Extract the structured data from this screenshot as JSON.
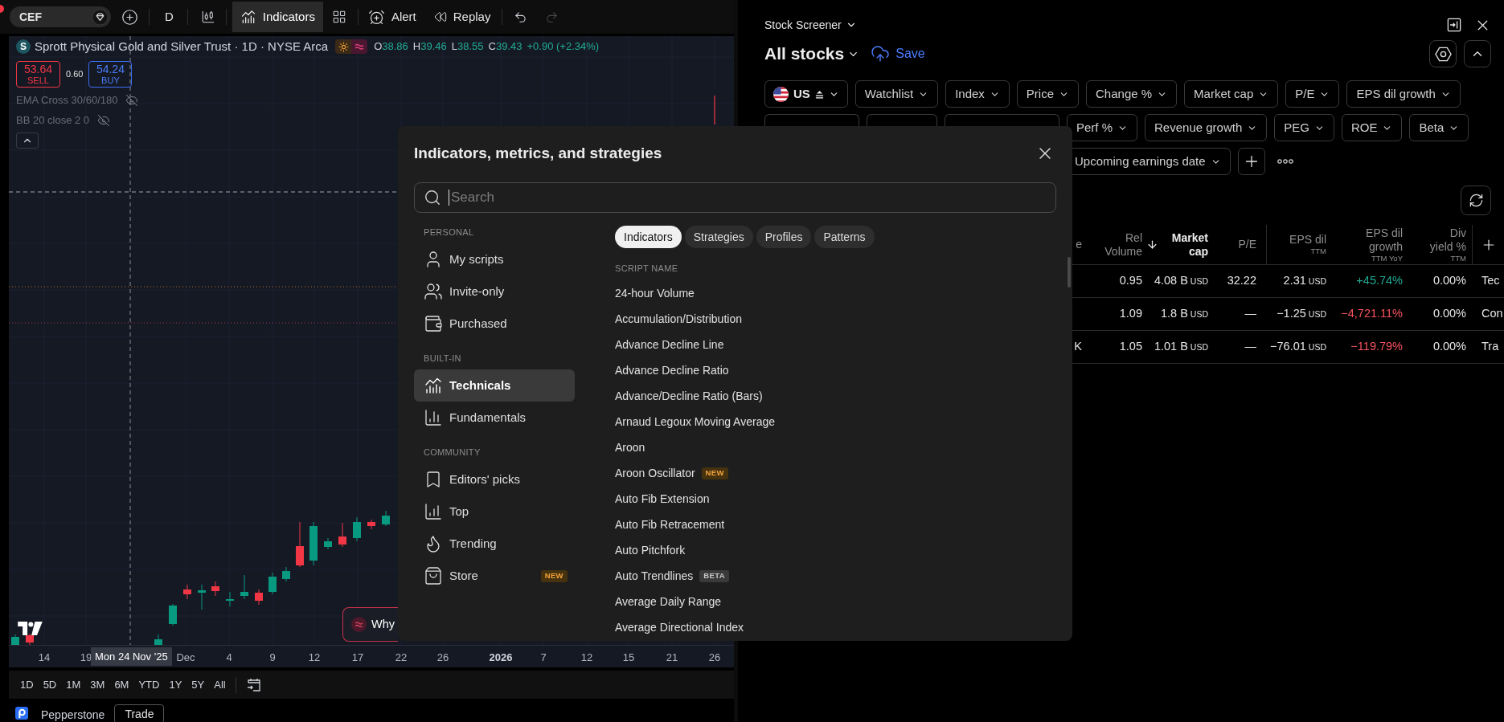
{
  "toolbar": {
    "symbol": "CEF",
    "interval": "D",
    "indicators": {
      "label": "Indicators",
      "active": true
    },
    "alert": "Alert",
    "replay": "Replay",
    "redo_disabled": true
  },
  "chart": {
    "logo_letter": "S",
    "title": "Sprott Physical Gold and Silver Trust · 1D · NYSE Arca",
    "ohlc": [
      {
        "label": "O",
        "value": "38.86"
      },
      {
        "label": "H",
        "value": "39.46"
      },
      {
        "label": "L",
        "value": "38.55"
      },
      {
        "label": "C",
        "value": "39.43"
      }
    ],
    "change": "+0.90 (+2.34%)",
    "sell": {
      "price": "53.64",
      "label": "SELL"
    },
    "spread": "0.60",
    "buy": {
      "price": "54.24",
      "label": "BUY"
    },
    "studies": [
      {
        "name": "EMA Cross 30/60/180",
        "hidden": true
      },
      {
        "name": "BB 20 close 2 0",
        "hidden": true
      }
    ],
    "why_button": "Why",
    "time_axis": [
      {
        "label": "14",
        "kind": "day"
      },
      {
        "label": "19",
        "kind": "day"
      },
      {
        "label": "Dec",
        "kind": "month"
      },
      {
        "label": "4",
        "kind": "day"
      },
      {
        "label": "9",
        "kind": "day"
      },
      {
        "label": "12",
        "kind": "day"
      },
      {
        "label": "17",
        "kind": "day"
      },
      {
        "label": "22",
        "kind": "day"
      },
      {
        "label": "26",
        "kind": "day"
      },
      {
        "label": "2026",
        "kind": "year"
      },
      {
        "label": "7",
        "kind": "day"
      },
      {
        "label": "12",
        "kind": "day"
      },
      {
        "label": "15",
        "kind": "day"
      },
      {
        "label": "21",
        "kind": "day"
      },
      {
        "label": "26",
        "kind": "day"
      }
    ],
    "crosshair_date": "Mon 24 Nov '25"
  },
  "ranges": [
    "1D",
    "5D",
    "1M",
    "3M",
    "6M",
    "YTD",
    "1Y",
    "5Y",
    "All"
  ],
  "broker": {
    "name": "Pepperstone",
    "action": "Trade"
  },
  "screener": {
    "title": "Stock Screener",
    "list_name": "All stocks",
    "save": "Save",
    "filter_rows": [
      [
        {
          "kind": "market",
          "label": "US"
        },
        {
          "kind": "dropdown",
          "label": "Watchlist"
        },
        {
          "kind": "dropdown",
          "label": "Index"
        },
        {
          "kind": "dropdown",
          "label": "Price"
        },
        {
          "kind": "dropdown",
          "label": "Change %"
        },
        {
          "kind": "dropdown",
          "label": "Market cap"
        },
        {
          "kind": "dropdown",
          "label": "P/E"
        },
        {
          "kind": "dropdown",
          "label": "EPS dil growth"
        }
      ],
      [
        {
          "kind": "covered"
        },
        {
          "kind": "covered"
        },
        {
          "kind": "covered"
        },
        {
          "kind": "dropdown",
          "label": "Perf %"
        },
        {
          "kind": "dropdown",
          "label": "Revenue growth"
        },
        {
          "kind": "dropdown",
          "label": "PEG"
        },
        {
          "kind": "dropdown",
          "label": "ROE"
        },
        {
          "kind": "dropdown",
          "label": "Beta"
        }
      ],
      [
        {
          "kind": "dropdown",
          "label": "Upcoming earnings date"
        },
        {
          "kind": "add"
        },
        {
          "kind": "more"
        }
      ]
    ],
    "table": {
      "partial_header": "e",
      "columns": [
        {
          "label": "Rel Volume",
          "sorted": false
        },
        {
          "label": "Market cap",
          "sorted": true
        },
        {
          "label": "P/E",
          "sorted": false
        },
        {
          "label": "EPS dil",
          "sub": "TTM",
          "sorted": false
        },
        {
          "label": "EPS dil growth",
          "sub": "TTM YoY",
          "sorted": false
        },
        {
          "label": "Div yield %",
          "sub": "TTM",
          "sorted": false
        }
      ],
      "add_column": true,
      "rows": [
        {
          "cells": [
            "0.95",
            {
              "value": "4.08 B",
              "unit": "USD"
            },
            "32.22",
            {
              "value": "2.31",
              "unit": "USD"
            },
            {
              "value": "+45.74%",
              "color": "#22ab94"
            },
            "0.00%",
            "Tec"
          ]
        },
        {
          "cells": [
            "1.09",
            {
              "value": "1.8 B",
              "unit": "USD"
            },
            "—",
            {
              "value": "−1.25",
              "unit": "USD"
            },
            {
              "value": "−4,721.11%",
              "color": "#f7525f"
            },
            "0.00%",
            "Con"
          ]
        },
        {
          "partial": "K",
          "cells": [
            "1.05",
            {
              "value": "1.01 B",
              "unit": "USD"
            },
            "—",
            {
              "value": "−76.01",
              "unit": "USD"
            },
            {
              "value": "−119.79%",
              "color": "#f7525f"
            },
            "0.00%",
            "Tra"
          ]
        }
      ]
    }
  },
  "dialog": {
    "title": "Indicators, metrics, and strategies",
    "search": {
      "placeholder": "Search"
    },
    "sections": [
      {
        "heading": "PERSONAL",
        "items": [
          {
            "label": "My scripts",
            "selected": false
          },
          {
            "label": "Invite-only",
            "selected": false
          },
          {
            "label": "Purchased",
            "selected": false
          }
        ]
      },
      {
        "heading": "BUILT-IN",
        "items": [
          {
            "label": "Technicals",
            "selected": true
          },
          {
            "label": "Fundamentals",
            "selected": false
          }
        ]
      },
      {
        "heading": "COMMUNITY",
        "items": [
          {
            "label": "Editors' picks",
            "selected": false
          },
          {
            "label": "Top",
            "selected": false
          },
          {
            "label": "Trending",
            "selected": false
          },
          {
            "label": "Store",
            "selected": false,
            "badge": {
              "label": "NEW",
              "kind": "new"
            }
          }
        ]
      }
    ],
    "tabs": [
      {
        "label": "Indicators",
        "selected": true
      },
      {
        "label": "Strategies",
        "selected": false
      },
      {
        "label": "Profiles",
        "selected": false
      },
      {
        "label": "Patterns",
        "selected": false
      }
    ],
    "list_heading": "SCRIPT NAME",
    "scripts": [
      {
        "name": "24-hour Volume"
      },
      {
        "name": "Accumulation/Distribution"
      },
      {
        "name": "Advance Decline Line"
      },
      {
        "name": "Advance Decline Ratio"
      },
      {
        "name": "Advance/Decline Ratio (Bars)"
      },
      {
        "name": "Arnaud Legoux Moving Average"
      },
      {
        "name": "Aroon"
      },
      {
        "name": "Aroon Oscillator",
        "badge": {
          "label": "NEW",
          "kind": "new"
        }
      },
      {
        "name": "Auto Fib Extension"
      },
      {
        "name": "Auto Fib Retracement"
      },
      {
        "name": "Auto Pitchfork"
      },
      {
        "name": "Auto Trendlines",
        "badge": {
          "label": "BETA",
          "kind": "beta"
        }
      },
      {
        "name": "Average Daily Range"
      },
      {
        "name": "Average Directional Index"
      }
    ]
  }
}
